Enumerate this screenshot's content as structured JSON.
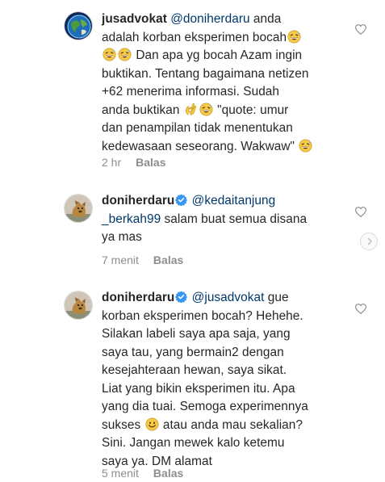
{
  "comments": [
    {
      "username": "jusadvokat",
      "lines": [
        {
          "parts": [
            {
              "t": "mention",
              "v": "@doniherdaru"
            },
            {
              "t": "text",
              "v": " anda"
            }
          ]
        },
        {
          "parts": [
            {
              "t": "text",
              "v": "adalah korban eksperimen bocah"
            },
            {
              "t": "emoji",
              "v": "grin-sweat"
            }
          ]
        },
        {
          "parts": [
            {
              "t": "emoji",
              "v": "grin-sweat"
            },
            {
              "t": "emoji",
              "v": "grin-sweat"
            },
            {
              "t": "text",
              "v": " Dan apa yg bocah Azam ingin"
            }
          ]
        },
        {
          "parts": [
            {
              "t": "text",
              "v": "buktikan. Tentang bagaimana netizen"
            }
          ]
        },
        {
          "parts": [
            {
              "t": "text",
              "v": "+62 menerima informasi. Sudah"
            }
          ]
        },
        {
          "parts": [
            {
              "t": "text",
              "v": "anda buktikan "
            },
            {
              "t": "emoji",
              "v": "ok-hand"
            },
            {
              "t": "emoji",
              "v": "grin-sweat"
            },
            {
              "t": "text",
              "v": " \"quote: umur"
            }
          ]
        },
        {
          "parts": [
            {
              "t": "text",
              "v": "dan penampilan tidak menentukan"
            }
          ]
        },
        {
          "parts": [
            {
              "t": "text",
              "v": "kedewasaan seseorang. Wakwaw\" "
            },
            {
              "t": "emoji",
              "v": "grin-sweat"
            }
          ]
        }
      ],
      "time": "2 hr",
      "reply_label": "Balas",
      "verified": false,
      "avatar": "globe"
    },
    {
      "username": "doniherdaru",
      "lines": [
        {
          "parts": [
            {
              "t": "mention",
              "v": "@kedaitanjung"
            }
          ]
        },
        {
          "parts": [
            {
              "t": "mention",
              "v": "_berkah99"
            },
            {
              "t": "text",
              "v": " salam buat semua disana"
            }
          ]
        },
        {
          "parts": [
            {
              "t": "text",
              "v": "ya mas"
            }
          ]
        }
      ],
      "time": "7 menit",
      "reply_label": "Balas",
      "verified": true,
      "avatar": "dog"
    },
    {
      "username": "doniherdaru",
      "lines": [
        {
          "parts": [
            {
              "t": "mention",
              "v": "@jusadvokat"
            },
            {
              "t": "text",
              "v": " gue"
            }
          ]
        },
        {
          "parts": [
            {
              "t": "text",
              "v": "korban eksperimen bocah? Hehehe."
            }
          ]
        },
        {
          "parts": [
            {
              "t": "text",
              "v": "Silakan labeli saya apa saja, yang"
            }
          ]
        },
        {
          "parts": [
            {
              "t": "text",
              "v": "saya tau, yang bermain2 dengan"
            }
          ]
        },
        {
          "parts": [
            {
              "t": "text",
              "v": "kesejahteraan hewan, saya sikat."
            }
          ]
        },
        {
          "parts": [
            {
              "t": "text",
              "v": "Liat yang bikin eksperimen itu. Apa"
            }
          ]
        },
        {
          "parts": [
            {
              "t": "text",
              "v": "yang dia tuai. Semoga experimennya"
            }
          ]
        },
        {
          "parts": [
            {
              "t": "text",
              "v": "sukses "
            },
            {
              "t": "emoji",
              "v": "smile"
            },
            {
              "t": "text",
              "v": " atau anda mau sekalian?"
            }
          ]
        },
        {
          "parts": [
            {
              "t": "text",
              "v": "Sini. Jangan mewek kalo ketemu"
            }
          ]
        },
        {
          "parts": [
            {
              "t": "text",
              "v": "saya ya. DM alamat"
            }
          ]
        }
      ],
      "time": "5 menit",
      "reply_label": "Balas",
      "verified": true,
      "avatar": "dog"
    }
  ],
  "icons": {
    "like": "heart-outline-icon",
    "verified": "verified-badge-icon",
    "scroll": "chevron-right-icon"
  },
  "colors": {
    "text": "#262626",
    "mention": "#00376b",
    "meta": "#8e8e8e",
    "verified": "#3897f0"
  }
}
